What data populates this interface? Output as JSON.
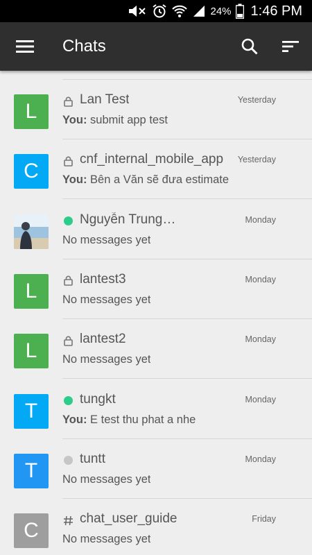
{
  "status_bar": {
    "battery_percent": "24%",
    "time": "1:46 PM",
    "icons": [
      "mute-icon",
      "alarm-icon",
      "wifi-icon",
      "signal-icon",
      "battery-icon"
    ]
  },
  "toolbar": {
    "title": "Chats",
    "icons": [
      "hamburger-menu-icon",
      "search-icon",
      "sort-icon"
    ],
    "background": "#2f2f2f"
  },
  "chats": [
    {
      "avatar_letter": "L",
      "avatar_color": "#4caf50",
      "status": "lock",
      "name": "Lan Test",
      "time": "Yesterday",
      "sender": "You:",
      "message": " submit app test"
    },
    {
      "avatar_letter": "C",
      "avatar_color": "#03a9f4",
      "status": "lock",
      "name": "cnf_internal_mobile_app",
      "time": "Yesterday",
      "sender": "You:",
      "message": " Bên a Văn sẽ đưa estimate"
    },
    {
      "avatar_letter": "",
      "avatar_color": "#7a8ea0",
      "avatar_photo": true,
      "status": "online",
      "name": "Nguyễn Trung…",
      "time": "Monday",
      "sender": "",
      "message": "No messages yet"
    },
    {
      "avatar_letter": "L",
      "avatar_color": "#4caf50",
      "status": "lock",
      "name": "lantest3",
      "time": "Monday",
      "sender": "",
      "message": "No messages yet"
    },
    {
      "avatar_letter": "L",
      "avatar_color": "#4caf50",
      "status": "lock",
      "name": "lantest2",
      "time": "Monday",
      "sender": "",
      "message": "No messages yet"
    },
    {
      "avatar_letter": "T",
      "avatar_color": "#03a9f4",
      "status": "online",
      "name": "tungkt",
      "time": "Monday",
      "sender": "You:",
      "message": " E test thu phat a nhe"
    },
    {
      "avatar_letter": "T",
      "avatar_color": "#2196f3",
      "status": "away",
      "name": "tuntt",
      "time": "Monday",
      "sender": "",
      "message": "No messages yet"
    },
    {
      "avatar_letter": "C",
      "avatar_color": "#9e9e9e",
      "status": "channel",
      "name": "chat_user_guide",
      "time": "Friday",
      "sender": "",
      "message": "No messages yet"
    }
  ],
  "colors": {
    "online": "#2ecc8a",
    "away": "#c6c6c6",
    "lock": "#777777"
  }
}
